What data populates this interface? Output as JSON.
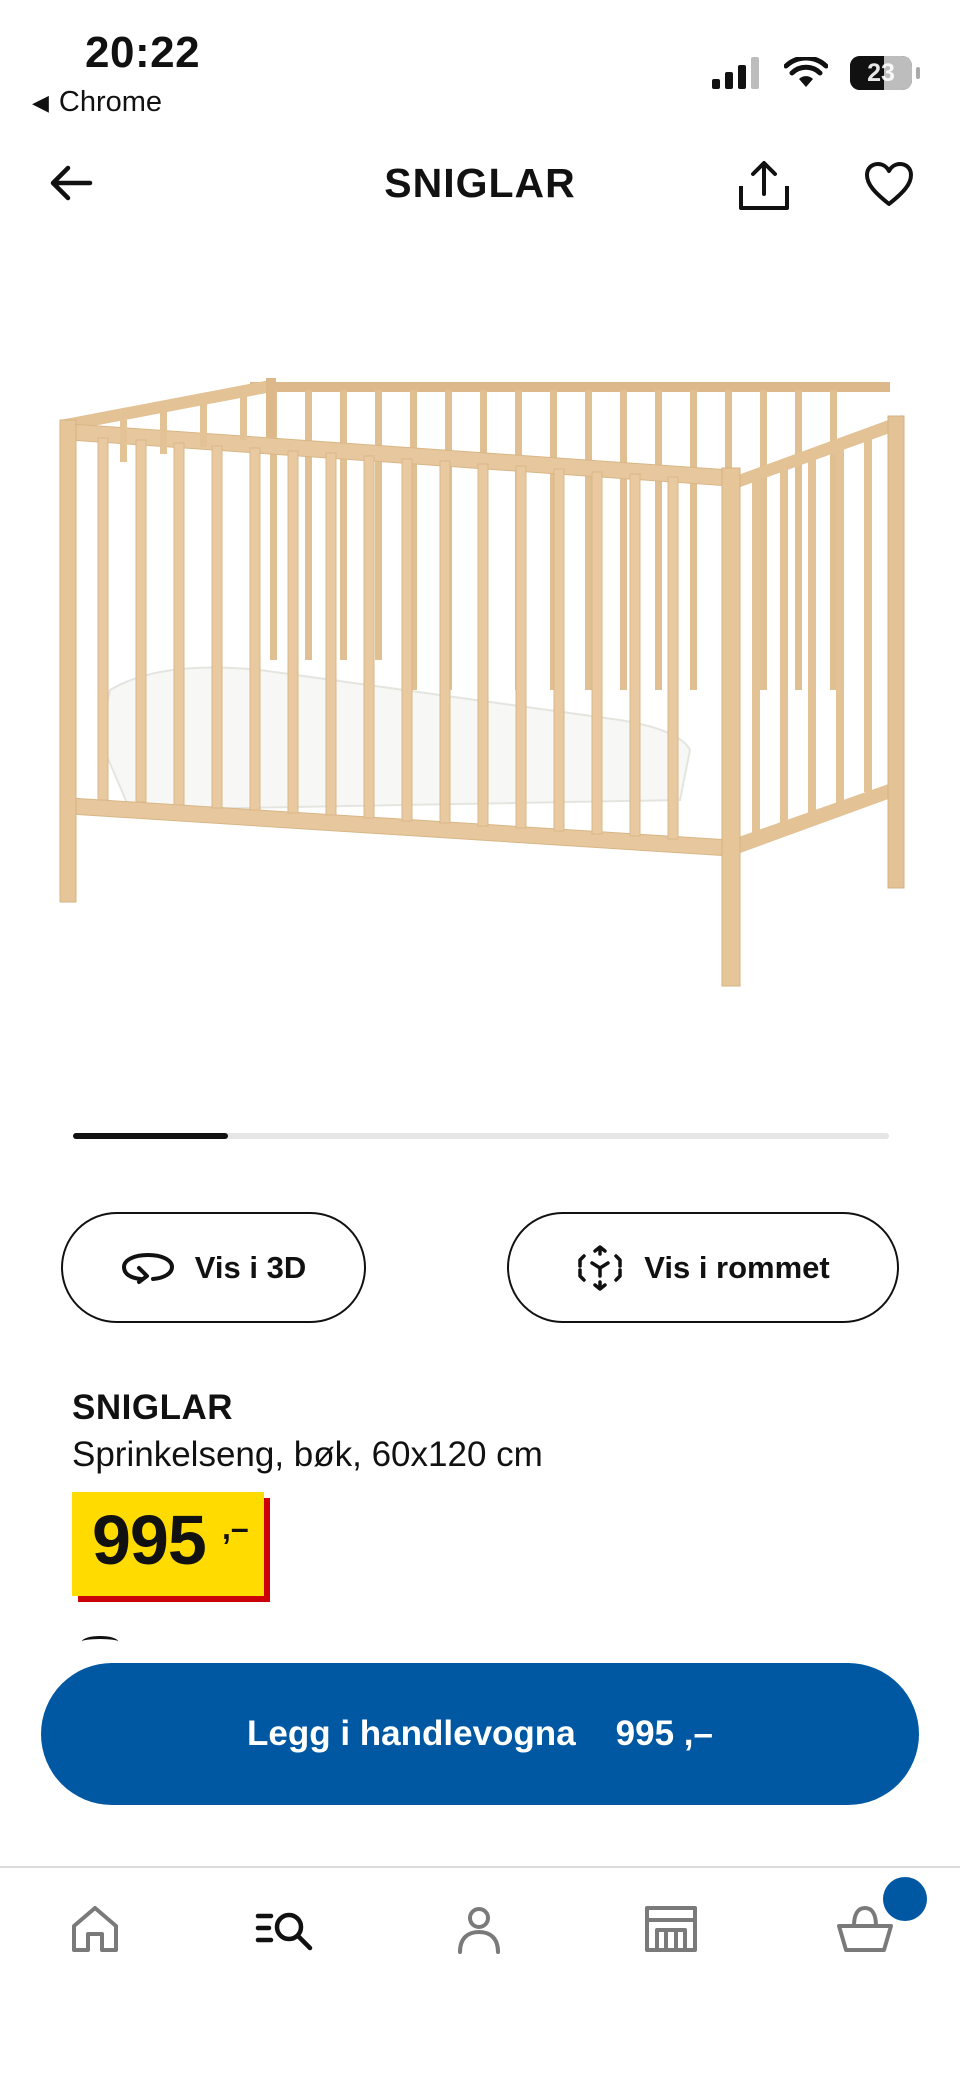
{
  "status_bar": {
    "time": "20:22",
    "back_app": "Chrome",
    "battery": "23"
  },
  "header": {
    "title": "SNIGLAR"
  },
  "product_image": {
    "alt": "SNIGLAR crib",
    "carousel_progress": 0.19
  },
  "actions": {
    "view_3d": "Vis i 3D",
    "view_room": "Vis i rommet"
  },
  "product": {
    "name": "SNIGLAR",
    "description": "Sprinkelseng, bøk, 60x120 cm",
    "price": "995",
    "price_suffix": ",–"
  },
  "cta": {
    "label": "Legg i handlevogna",
    "price": "995 ,–"
  },
  "bottom_nav": {
    "items": [
      "home-icon",
      "search-icon",
      "profile-icon",
      "store-icon",
      "basket-icon"
    ]
  },
  "colors": {
    "ikea_blue": "#0058a3",
    "price_yellow": "#ffdb00",
    "price_red": "#cc0008",
    "wood": "#e7c79d"
  }
}
